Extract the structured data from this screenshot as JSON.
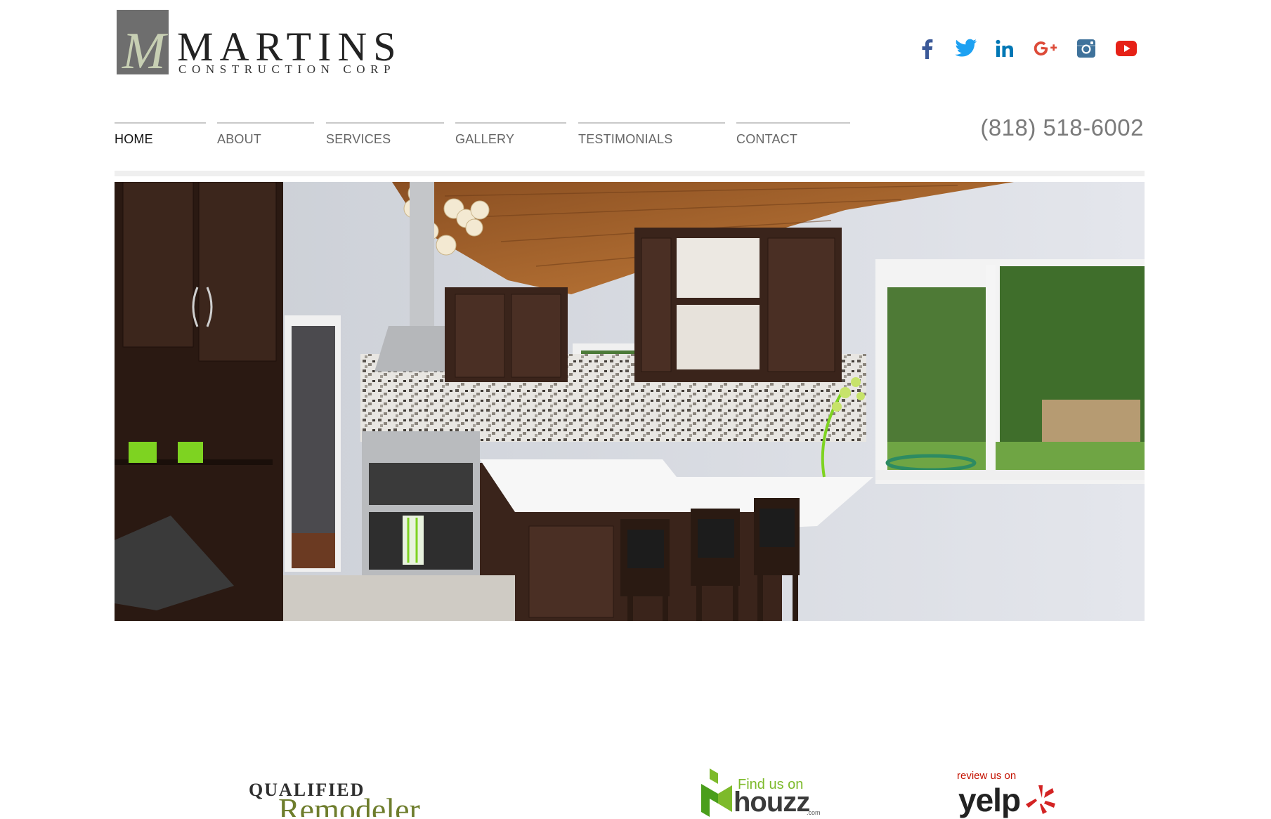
{
  "brand": {
    "monogram": "M",
    "name": "MARTINS",
    "tagline": "CONSTRUCTION CORP"
  },
  "social": [
    {
      "icon": "facebook-icon",
      "color": "#3b5998"
    },
    {
      "icon": "twitter-icon",
      "color": "#1da1f2"
    },
    {
      "icon": "linkedin-icon",
      "color": "#0077b5"
    },
    {
      "icon": "google-plus-icon",
      "color": "#dd4b39"
    },
    {
      "icon": "instagram-icon",
      "color": "#3f729b"
    },
    {
      "icon": "youtube-icon",
      "color": "#e62117"
    }
  ],
  "nav": {
    "items": [
      {
        "label": "HOME",
        "active": true
      },
      {
        "label": "ABOUT"
      },
      {
        "label": "SERVICES"
      },
      {
        "label": "GALLERY"
      },
      {
        "label": "TESTIMONIALS"
      },
      {
        "label": "CONTACT"
      }
    ],
    "phone": "(818) 518-6002"
  },
  "badges": {
    "remodeler": {
      "line1": "QUALIFIED",
      "line2": "Remodeler"
    },
    "houzz": {
      "line1": "Find us on",
      "line2": "houzz",
      "suffix": ".com"
    },
    "yelp": {
      "line1": "review us on",
      "line2": "yelp"
    }
  },
  "colors": {
    "accent_green": "#7dba2b",
    "nav_rule": "#c9c9c9",
    "text_gray": "#666666"
  }
}
